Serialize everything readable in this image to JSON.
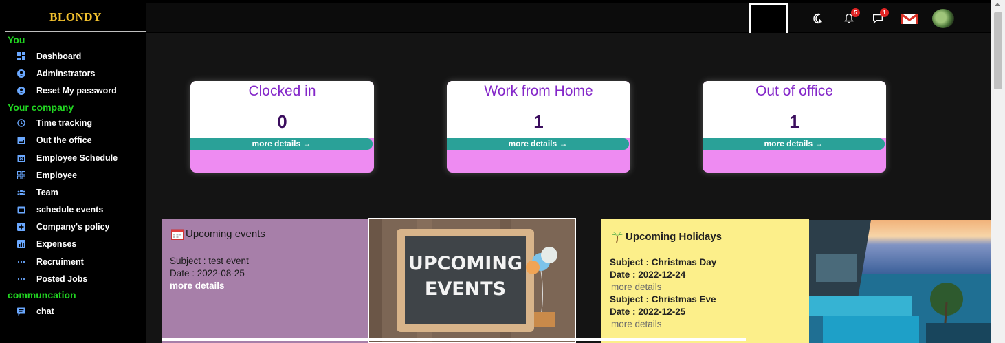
{
  "brand": "BLONDY",
  "sidebar": {
    "sections": [
      {
        "title": "You",
        "items": [
          {
            "label": "Dashboard",
            "icon": "dashboard-icon"
          },
          {
            "label": "Adminstrators",
            "icon": "user-circle-icon"
          },
          {
            "label": "Reset My password",
            "icon": "user-circle-icon"
          }
        ]
      },
      {
        "title": "Your company",
        "items": [
          {
            "label": "Time tracking",
            "icon": "history-icon"
          },
          {
            "label": "Out the office",
            "icon": "calendar-icon"
          },
          {
            "label": "Employee Schedule",
            "icon": "calendar-x-icon"
          },
          {
            "label": "Employee",
            "icon": "grid-icon"
          },
          {
            "label": "Team",
            "icon": "team-icon"
          },
          {
            "label": "schedule events",
            "icon": "calendar-icon"
          },
          {
            "label": "Company's policy",
            "icon": "plus-square-icon"
          },
          {
            "label": "Expenses",
            "icon": "bar-chart-icon"
          },
          {
            "label": "Recruiment",
            "icon": "ellipsis-icon"
          },
          {
            "label": "Posted Jobs",
            "icon": "ellipsis-icon"
          }
        ]
      },
      {
        "title": "communcation",
        "items": [
          {
            "label": "chat",
            "icon": "chat-icon"
          }
        ]
      }
    ]
  },
  "topbar": {
    "notifications_count": "5",
    "messages_count": "1"
  },
  "stats": [
    {
      "title": "Clocked in",
      "value": "0",
      "more": "more details →"
    },
    {
      "title": "Work from Home",
      "value": "1",
      "more": "more details →"
    },
    {
      "title": "Out of office",
      "value": "1",
      "more": "more details →"
    }
  ],
  "events": {
    "title": "Upcoming events",
    "items": [
      {
        "subject": "Subject : test event",
        "date": "Date : 2022-08-25",
        "more": "more details"
      }
    ],
    "image_text_line1": "UPCOMING",
    "image_text_line2": "EVENTS"
  },
  "holidays": {
    "title": "Upcoming Holidays",
    "items": [
      {
        "subject": "Subject : Christmas Day",
        "date": "Date : 2022-12-24",
        "more": "more details"
      },
      {
        "subject": "Subject : Christmas Eve",
        "date": "Date : 2022-12-25",
        "more": "more details"
      }
    ]
  },
  "colors": {
    "brand": "#f2c12e",
    "section": "#21d421",
    "stat_title": "#8427c9",
    "stat_bar": "#2aa198",
    "stat_bottom": "#ee8bf2",
    "events_bg": "#a77fa9",
    "holidays_bg": "#fcef8a"
  }
}
